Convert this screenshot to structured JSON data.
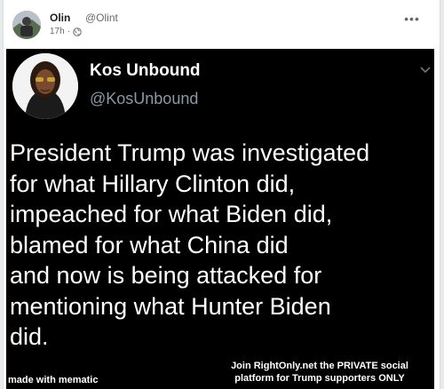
{
  "post": {
    "author_name": "Olin",
    "author_handle": "@Olint",
    "timestamp": "17h",
    "privacy_icon": "globe-icon",
    "more_label": "•••"
  },
  "tweet": {
    "display_name": "Kos Unbound",
    "handle": "@KosUnbound",
    "lines": [
      "President Trump was investigated",
      "for what Hillary Clinton did,",
      "impeached for what Biden did,",
      "blamed for what China did",
      "and now is being attacked for",
      "mentioning what Hunter Biden",
      "did."
    ]
  },
  "watermark": {
    "maker": "made with mematic",
    "promo_line_1": "Join RightOnly.net the PRIVATE social",
    "promo_line_2": "platform for Trump supporters ONLY"
  },
  "colors": {
    "meme_background": "#000000",
    "tweet_text": "#ffffff",
    "tweet_handle": "#8b98a5",
    "post_meta": "#65676b"
  }
}
